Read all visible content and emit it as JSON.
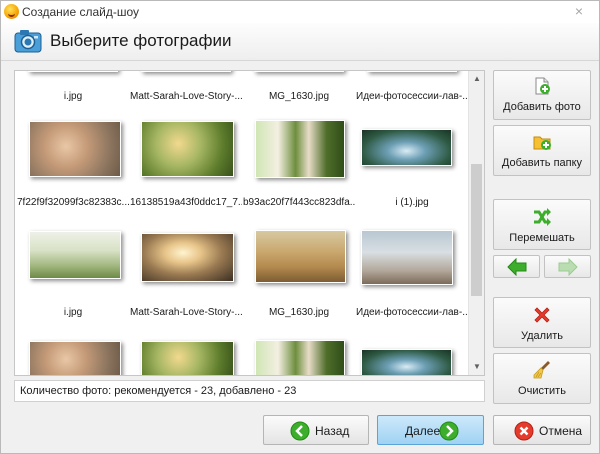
{
  "window": {
    "title": "Создание слайд-шоу",
    "close_glyph": "×"
  },
  "header": {
    "title": "Выберите фотографии",
    "icon": "camera-icon"
  },
  "gallery": {
    "rows": [
      {
        "captions": [
          "i.jpg",
          "Matt-Sarah-Love-Story-...",
          "MG_1630.jpg",
          "Идеи-фотосессии-лав-..."
        ]
      },
      {
        "captions": [
          "7f22f9f32099f3c82383c...",
          "16138519a43f0ddc17_7...",
          "b93ac20f7f443cc823dfa...",
          "i (1).jpg"
        ]
      },
      {
        "captions": [
          "i.jpg",
          "Matt-Sarah-Love-Story-...",
          "MG_1630.jpg",
          "Идеи-фотосессии-лав-..."
        ]
      },
      {
        "captions": [
          "",
          "",
          "",
          ""
        ]
      }
    ],
    "scroll_up_glyph": "▲",
    "scroll_down_glyph": "▼"
  },
  "status": {
    "text": "Количество фото: рекомендуется - 23, добавлено - 23"
  },
  "sidebar": {
    "add_photo": "Добавить фото",
    "add_folder": "Добавить папку",
    "shuffle": "Перемешать",
    "delete": "Удалить",
    "clear": "Очистить"
  },
  "footer": {
    "back": "Назад",
    "next": "Далее",
    "cancel": "Отмена"
  },
  "colors": {
    "accent_green": "#3dae2b",
    "delete_red": "#e53b2c",
    "primary_button": "#a9d8f5"
  }
}
